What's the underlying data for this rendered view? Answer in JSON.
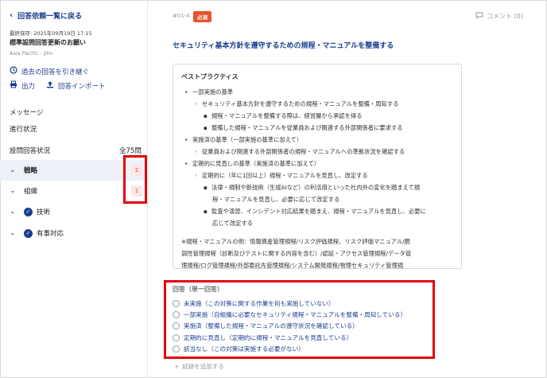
{
  "sidebar": {
    "back_label": "回答依頼一覧に戻る",
    "saved_at": "最終保存: 2025年09月19日 17:15",
    "request_title": "標準設問回答更新のお願い",
    "region": "Asia Pacific - Jilin",
    "carry_over_label": "過去の回答を引き継ぐ",
    "output_label": "出力",
    "import_label": "回答インポート",
    "message_label": "メッセージ",
    "progress_label": "進行状況",
    "status_label": "設問回答状況",
    "total_count": "全75問",
    "categories": [
      {
        "label": "戦略",
        "badge": "2",
        "done": false
      },
      {
        "label": "組織",
        "badge": "1",
        "done": false
      },
      {
        "label": "技術",
        "badge": "",
        "done": true
      },
      {
        "label": "有事対応",
        "badge": "",
        "done": true
      }
    ]
  },
  "question": {
    "id": "#01-4",
    "required_tag": "必須",
    "comment_label": "コメント (0)",
    "title": "セキュリティ基本方針を遵守するための規程・マニュアルを整備する"
  },
  "best_practice": {
    "title": "ベストプラクティス",
    "lines": [
      {
        "level": 1,
        "bullet": "•",
        "text": "一部実施の基準"
      },
      {
        "level": 2,
        "bullet": "◦",
        "text": "セキュリティ基本方針を遵守するための規程・マニュアルを整備・周知する"
      },
      {
        "level": 3,
        "bullet": "▪",
        "text": "規程・マニュアルを整備する際は、経営層から承認を得る"
      },
      {
        "level": 3,
        "bullet": "▪",
        "text": "整備した規程・マニュアルを従業員および関連する外部関係者に要求する"
      },
      {
        "level": 1,
        "bullet": "•",
        "text": "実施済の基準（一部実施の基準に加えて）"
      },
      {
        "level": 2,
        "bullet": "◦",
        "text": "従業員および関連する外部関係者の規程・マニュアルへの準拠状況を確認する"
      },
      {
        "level": 1,
        "bullet": "•",
        "text": "定期的に見直しの基準（実施済の基準に加えて）"
      },
      {
        "level": 2,
        "bullet": "◦",
        "text": "定期的に（年に1回以上）規程・マニュアルを見直し、改定する"
      },
      {
        "level": 3,
        "bullet": "▪",
        "text": "法律・規制や新技術（生成AIなど）の利活用といった社内外の変化を踏まえて規"
      },
      {
        "level": 4,
        "bullet": "",
        "text": "程・マニュアルを見直し、必要に応じて改定する"
      },
      {
        "level": 3,
        "bullet": "▪",
        "text": "監査や演習、インシデント対応結果を踏まえ、規程・マニュアルを見直し、必要に"
      },
      {
        "level": 4,
        "bullet": "",
        "text": "応じて改定する"
      }
    ],
    "note_lines": [
      "※規程・マニュアルの例：情報資産管理規程/リスク評価規程、リスク評価マニュアル/脆",
      "弱性管理規程（診断及びテストに関する内容を含む）/認証・アクセス管理規程/データ管",
      "理規程/ログ管理規程/外部委託先管理規程/システム開発規程/物理セキュリティ管理規"
    ]
  },
  "answer": {
    "title": "回答（単一回答）",
    "options": [
      "未実施（この対策に関する作業を何も実施していない）",
      "一部実施（自組織に必要なセキュリティ規程・マニュアルを整備・周知している）",
      "実施済（整備した規程・マニュアルの遵守状況を確認している）",
      "定期的に見直し（定期的に規程・マニュアルを見直している）",
      "該当なし（この対策は実施する必要がない）"
    ],
    "add_evidence_label": "証跡を追加する"
  }
}
